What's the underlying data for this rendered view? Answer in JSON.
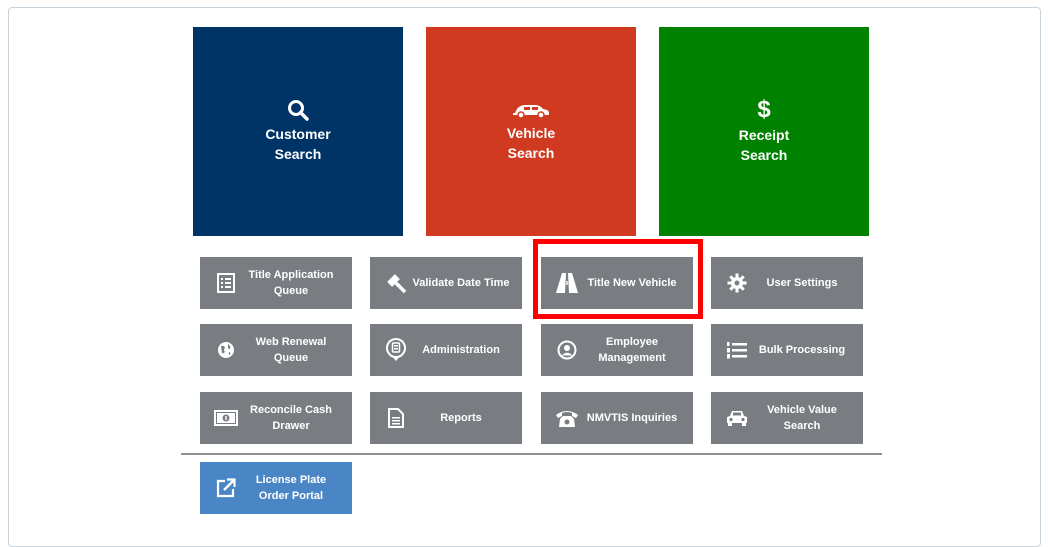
{
  "tiles": [
    {
      "label": "Customer\nSearch",
      "icon": "search-icon",
      "color": "#003466"
    },
    {
      "label": "Vehicle\nSearch",
      "icon": "car-icon",
      "color": "#d03a20"
    },
    {
      "label": "Receipt\nSearch",
      "icon": "dollar-icon",
      "color": "#008200"
    }
  ],
  "buttons": {
    "title_application_queue": "Title Application\nQueue",
    "validate_date_time": "Validate Date Time",
    "title_new_vehicle": "Title New Vehicle",
    "user_settings": "User Settings",
    "web_renewal_queue": "Web Renewal\nQueue",
    "administration": "Administration",
    "employee_management": "Employee\nManagement",
    "bulk_processing": "Bulk Processing",
    "reconcile_cash_drawer": "Reconcile Cash\nDrawer",
    "reports": "Reports",
    "nmvtis_inquiries": "NMVTIS Inquiries",
    "vehicle_value_search": "Vehicle Value\nSearch",
    "license_plate_order_portal": "License Plate\nOrder Portal"
  },
  "colors": {
    "button_gray": "#797d81",
    "button_blue": "#4a86c6",
    "highlight": "#ff0000"
  }
}
